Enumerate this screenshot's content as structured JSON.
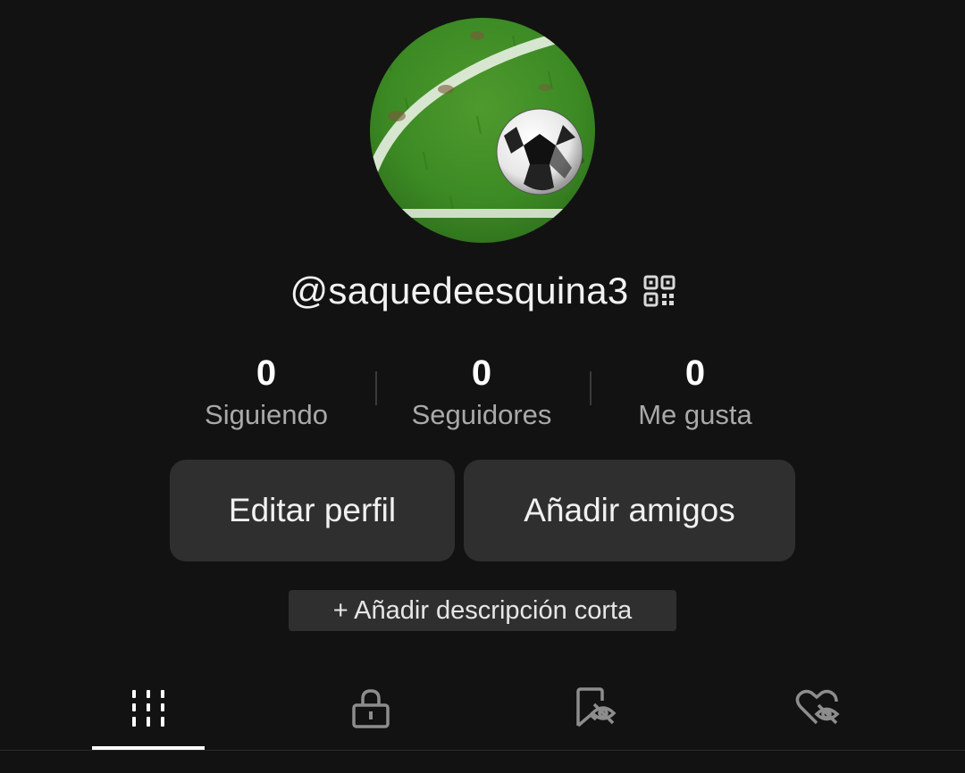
{
  "profile": {
    "username": "@saquedeesquina3",
    "avatar_icon": "soccer-ball-on-grass-avatar",
    "qr_icon": "qr-code-icon"
  },
  "stats": [
    {
      "value": "0",
      "label": "Siguiendo"
    },
    {
      "value": "0",
      "label": "Seguidores"
    },
    {
      "value": "0",
      "label": "Me gusta"
    }
  ],
  "actions": {
    "edit_profile": "Editar perfil",
    "add_friends": "Añadir amigos",
    "add_bio": "+ Añadir descripción corta"
  },
  "tabs": [
    {
      "icon": "videos-grid-icon",
      "active": true
    },
    {
      "icon": "private-lock-icon",
      "active": false
    },
    {
      "icon": "saved-hidden-icon",
      "active": false
    },
    {
      "icon": "liked-hidden-icon",
      "active": false
    }
  ],
  "colors": {
    "background": "#121212",
    "button": "#2f2f2f",
    "secondary_text": "#a9a9a9"
  }
}
